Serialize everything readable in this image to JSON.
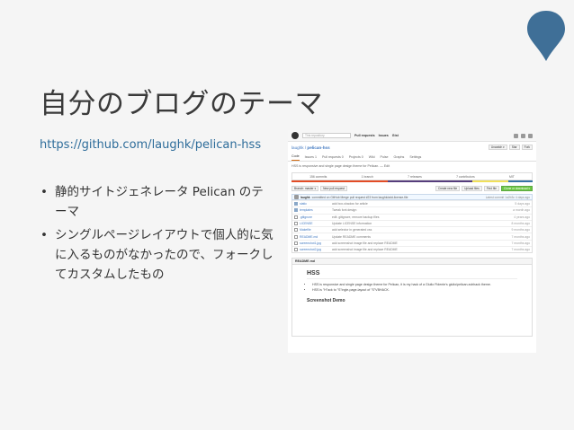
{
  "slide": {
    "title": "自分のブログのテーマ",
    "link": "https://github.com/laughk/pelican-hss",
    "bullets": [
      "静的サイトジェネレータ Pelican のテーマ",
      "シングルページレイアウトで個人的に気に入るものがなかったので、フォークしてカスタムしたもの"
    ]
  },
  "colors": {
    "accent": "#3f6f97",
    "link": "#2d6c9a",
    "title": "#3a3a3a"
  },
  "github": {
    "search_placeholder": "This repository",
    "search_btn": "Search",
    "nav": [
      "Pull requests",
      "Issues",
      "Gist"
    ],
    "repo_owner": "laughk",
    "repo_name": "pelican-hss",
    "repo_buttons": [
      "Unwatch ▾",
      "Star",
      "Fork"
    ],
    "tabs": [
      "Code",
      "Issues 1",
      "Pull requests 0",
      "Projects 0",
      "Wiki",
      "Pulse",
      "Graphs",
      "Settings"
    ],
    "description": "HSS is responsive and single page design theme for Pelican. — Edit",
    "stats": [
      "156 commits",
      "1 branch",
      "7 releases",
      "7 contributors",
      "MIT"
    ],
    "lang_colors": [
      "#e34c26",
      "#563d7c",
      "#f1e05a",
      "#3572a5"
    ],
    "branch": "Branch: master ▾",
    "new_pr": "New pull request",
    "file_actions": [
      "Create new file",
      "Upload files",
      "Find file"
    ],
    "clone": "Clone or download ▾",
    "commit": {
      "author": "laughk",
      "message": "committed on GitHub Merge pull request #23 from laughk/add-license-file",
      "when": "Latest commit 1a2b3c 4 days ago"
    },
    "files": [
      {
        "name": "static",
        "type": "dir",
        "message": "add box-shadow for article",
        "age": "5 days ago"
      },
      {
        "name": "templates",
        "type": "dir",
        "message": "Tweak font design",
        "age": "a month ago"
      },
      {
        "name": ".gitignore",
        "type": "file",
        "message": "edit .gitignore, remove backup files",
        "age": "4 years ago"
      },
      {
        "name": "LICENSE",
        "type": "file",
        "message": "Update LICENSE information",
        "age": "8 months ago"
      },
      {
        "name": "Makefile",
        "type": "file",
        "message": "add selector in generated css",
        "age": "9 months ago"
      },
      {
        "name": "README.md",
        "type": "file",
        "message": "Update README comments",
        "age": "7 months ago"
      },
      {
        "name": "screenshot1.jpg",
        "type": "file",
        "message": "add screenshot image file and replace README",
        "age": "7 months ago"
      },
      {
        "name": "screenshot2.jpg",
        "type": "file",
        "message": "add screenshot image file and replace README",
        "age": "7 months ago"
      }
    ],
    "readme_title": "README.md",
    "readme_h1": "HSS",
    "readme_items": [
      "HSS is responsive and single page design theme for Pelican, it is my hack of a Giulio Fidente's giulio/pelican-svbhack theme.",
      "HSS is \"H\"ack to \"S\"ingle-page-layout of \"S\"VBHACK."
    ],
    "readme_h2": "Screenshot Demo"
  }
}
